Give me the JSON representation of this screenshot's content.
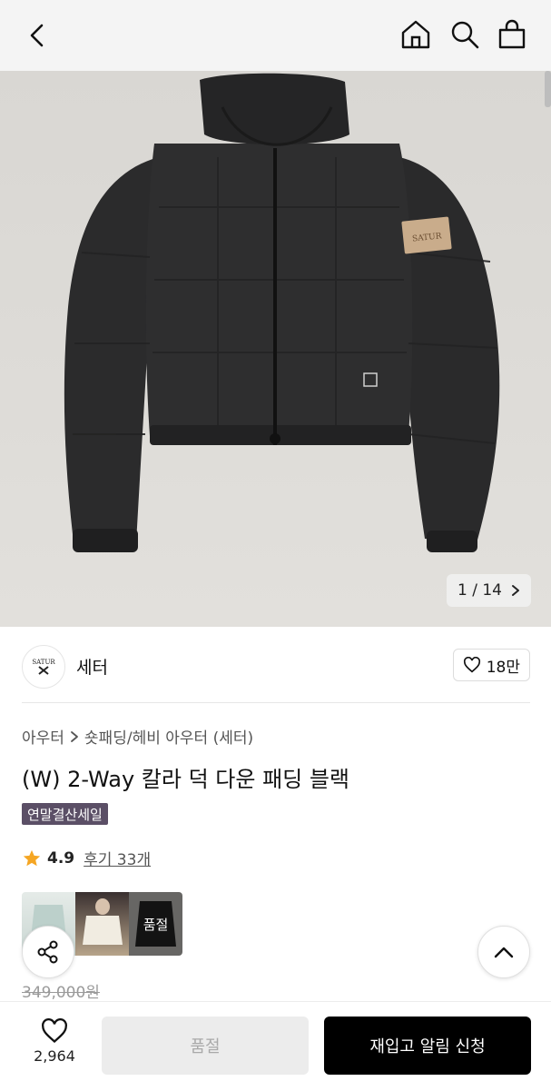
{
  "header": {
    "icons": [
      "back-icon",
      "home-icon",
      "search-icon",
      "bag-icon"
    ]
  },
  "gallery": {
    "counter": "1 / 14",
    "patch_text": "SATUR"
  },
  "brand": {
    "logo_text": "SATUR",
    "name": "세터",
    "likes": "18만"
  },
  "breadcrumb": {
    "level1": "아우터",
    "level2": "숏패딩/헤비 아우터 (세터)"
  },
  "product": {
    "title": "(W) 2-Way 칼라 덕 다운 패딩 블랙",
    "badge": "연말결산세일",
    "rating": "4.9",
    "reviews": "후기 33개",
    "price_original": "349,000원"
  },
  "thumbnails": {
    "soldout_label": "품절"
  },
  "bottom_bar": {
    "wish_count": "2,964",
    "soldout_button": "품절",
    "restock_button": "재입고 알림 신청"
  },
  "colors": {
    "badge_bg": "#5b4f66",
    "primary_button": "#000000",
    "star": "#f5a623"
  }
}
